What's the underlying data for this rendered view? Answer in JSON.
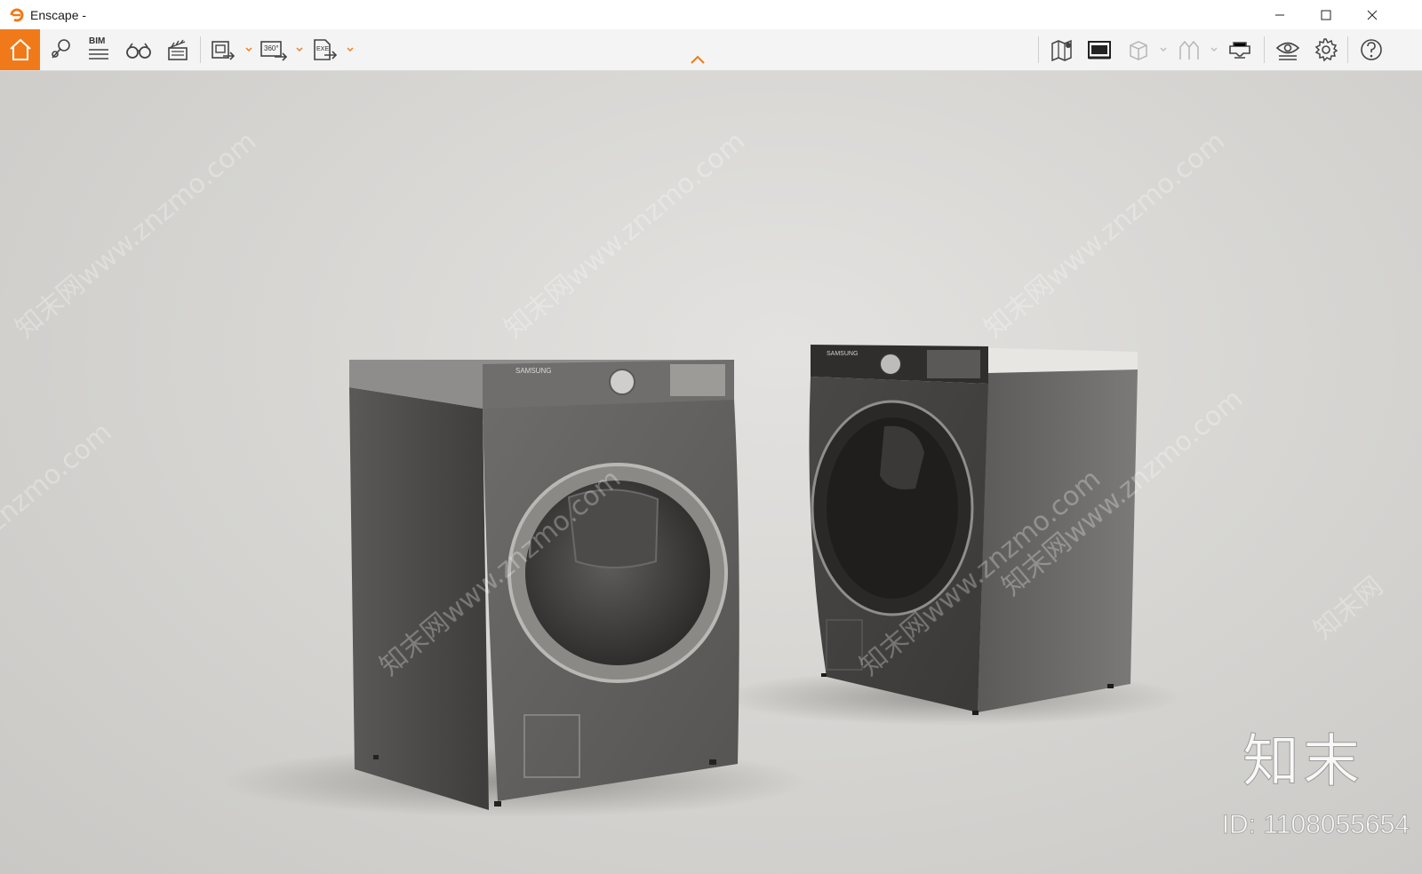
{
  "window": {
    "title": "Enscape -"
  },
  "toolbar": {
    "bim_label": "BIM",
    "pano_label": "360°",
    "exe_label": "EXE",
    "accent_color": "#f07a1a",
    "left_icons": [
      "home-icon",
      "views-icon",
      "bim-icon",
      "binoculars-icon",
      "clapperboard-icon",
      "screenshot-export-icon",
      "panorama-export-icon",
      "exe-export-icon"
    ],
    "right_icons": [
      "map-icon",
      "asset-library-icon",
      "cube-icon",
      "materials-icon",
      "vr-headset-icon",
      "visibility-icon",
      "settings-icon",
      "help-icon"
    ]
  },
  "viewport": {
    "watermarks": [
      "知末网www.znzmo.com",
      "知末网www.znzmo.com",
      "知末网www.znzmo.com",
      "znzmo.com",
      "知末网www.znzmo.com",
      "知末网www.znzmo.com",
      "知末网www.znzmo.com",
      "知末网"
    ],
    "brand": "知末",
    "image_id": "ID: 1108055654",
    "left_machine_brand": "SAMSUNG",
    "right_machine_brand": "SAMSUNG"
  }
}
